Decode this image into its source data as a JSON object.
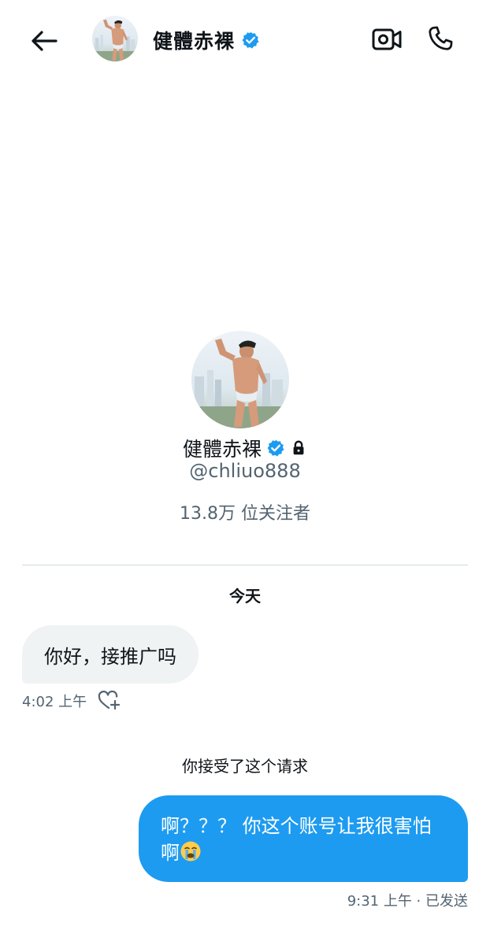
{
  "header": {
    "display_name": "健體赤裸",
    "verified": true,
    "icons": [
      "back-arrow-icon",
      "verified-badge-icon",
      "video-call-icon",
      "phone-icon"
    ]
  },
  "profile": {
    "display_name": "健體赤裸",
    "handle": "@chliuo888",
    "followers": "13.8万 位关注者",
    "verified": true,
    "protected": true
  },
  "conversation": {
    "date_label": "今天",
    "messages": [
      {
        "direction": "incoming",
        "text": "你好，接推广吗",
        "time": "4:02 上午"
      },
      {
        "direction": "system",
        "text": "你接受了这个请求"
      },
      {
        "direction": "outgoing",
        "text": "啊？？？ 你这个账号让我很害怕啊",
        "emoji": "crying-face-emoji",
        "status": "9:31 上午 · 已发送"
      }
    ]
  },
  "colors": {
    "accent": "#1d9bf0",
    "bubble_incoming": "#eff3f4",
    "secondary_text": "#536471",
    "divider": "#cfd9de"
  }
}
